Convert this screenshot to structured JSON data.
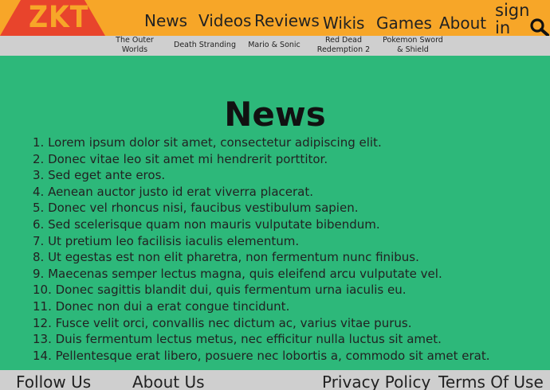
{
  "header": {
    "logo_text": "ZKT",
    "nav": [
      "News",
      "Videos",
      "Reviews",
      "Wikis",
      "Games",
      "About"
    ],
    "signin_label": "sign in"
  },
  "subnav": {
    "items": [
      "The Outer Worlds",
      "Death Stranding",
      "Mario & Sonic",
      "Red Dead Redemption 2",
      "Pokemon Sword & Shield"
    ]
  },
  "main": {
    "title": "News",
    "items": [
      "1. Lorem ipsum dolor sit amet, consectetur adipiscing elit.",
      "2. Donec vitae leo sit amet mi hendrerit porttitor.",
      "3. Sed eget ante eros.",
      "4. Aenean auctor justo id erat viverra placerat.",
      "5. Donec vel rhoncus nisi, faucibus vestibulum sapien.",
      "6. Sed scelerisque quam non mauris vulputate bibendum.",
      "7. Ut pretium leo facilisis iaculis elementum.",
      "8. Ut egestas est non elit pharetra, non fermentum nunc finibus.",
      "9. Maecenas semper lectus magna, quis eleifend arcu vulputate vel.",
      "10. Donec sagittis blandit dui, quis fermentum urna iaculis eu.",
      "11. Donec non dui a erat congue tincidunt.",
      "12. Fusce velit orci, convallis nec dictum ac, varius vitae purus.",
      "13. Duis fermentum lectus metus, nec efficitur nulla luctus sit amet.",
      "14. Pellentesque erat libero, posuere nec lobortis a, commodo sit amet erat."
    ]
  },
  "footer": {
    "links": [
      "Follow Us",
      "About Us",
      "Privacy Policy",
      "Terms Of Use"
    ]
  },
  "colors": {
    "header_bg": "#f7a628",
    "logo_bg": "#e8442c",
    "page_bg": "#2db87a",
    "bar_bg": "#cfcfcf"
  },
  "icons": {
    "search": "search-icon"
  }
}
